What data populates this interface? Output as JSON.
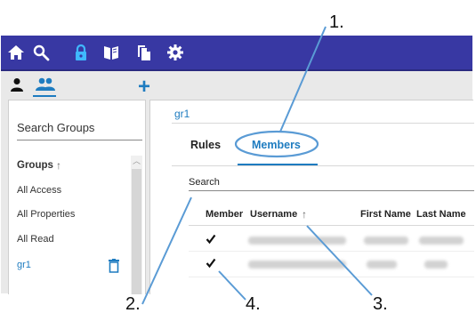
{
  "callouts": [
    "1.",
    "2.",
    "3.",
    "4."
  ],
  "toolbar": {
    "icons": [
      "home-icon",
      "search-icon",
      "lock-icon",
      "book-icon",
      "documents-icon",
      "gear-icon"
    ]
  },
  "left": {
    "add_label": "+",
    "search_placeholder": "Search Groups",
    "groups_header": "Groups",
    "sort_arrow": "↑",
    "items": [
      "All Access",
      "All Properties",
      "All Read",
      "gr1"
    ]
  },
  "right": {
    "group_title": "gr1",
    "tabs": [
      "Rules",
      "Members"
    ],
    "search_placeholder": "Search",
    "columns": [
      "Member",
      "Username",
      "First Name",
      "Last Name"
    ],
    "sort_arrow": "↑"
  },
  "colors": {
    "nav": "#3838a3",
    "accent": "#1e7cc0",
    "callout_line": "#5a9bd5"
  }
}
